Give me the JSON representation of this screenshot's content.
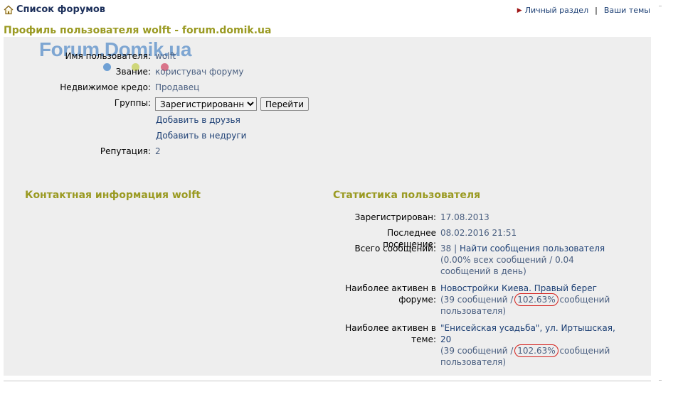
{
  "topbar": {
    "home_label": "Список форумов",
    "links": [
      "Личный раздел",
      "Ваши темы"
    ],
    "separator": "|"
  },
  "page_title": "Профиль пользователя wolft - forum.domik.ua",
  "logo": {
    "text": "Forum.Domik.ua",
    "dot_colors": [
      "#6fa0d4",
      "#cfd77a",
      "#d9748a"
    ]
  },
  "profile": {
    "username_label": "Имя пользователя:",
    "username": "wolft",
    "rank_label": "Звание:",
    "rank": "користувач форуму",
    "credo_label": "Недвижимое кредо:",
    "credo": "Продавец",
    "groups_label": "Группы:",
    "groups_selected": "Зарегистрированные",
    "go_button": "Перейти",
    "add_friend": "Добавить в друзья",
    "add_foe": "Добавить в недруги",
    "reputation_label": "Репутация:",
    "reputation": "2"
  },
  "contact": {
    "title": "Контактная информация wolft"
  },
  "stats": {
    "title": "Статистика пользователя",
    "registered_label": "Зарегистрирован:",
    "registered": "17.08.2013",
    "last_visit_label": "Последнее посещение:",
    "last_visit": "08.02.2016 21:51",
    "total_posts_label": "Всего сообщений:",
    "total_posts": "38",
    "total_sep": " | ",
    "find_posts": "Найти сообщения пользователя",
    "total_detail": "(0.00% всех сообщений / 0.04 сообщений в день)",
    "active_forum_label_1": "Наиболее активен в",
    "active_forum_label_2": "форуме:",
    "active_forum": "Новостройки Киева. Правый берег",
    "forum_pre": "(39 сообщений / ",
    "forum_pct": "102.63%",
    "forum_post_1": " сообщений",
    "forum_post_2": "пользователя)",
    "active_topic_label_1": "Наиболее активен в",
    "active_topic_label_2": "теме:",
    "active_topic": "\"Енисейская усадьба\", ул. Иртышская, 20",
    "topic_pre": "(39 сообщений / ",
    "topic_pct": "102.63%",
    "topic_post_1": " сообщений",
    "topic_post_2": "пользователя)"
  },
  "colors": {
    "title": "#9a9a22",
    "link": "#1c3f74",
    "panel_bg": "#eeeeee",
    "annotation": "#d4201c"
  }
}
